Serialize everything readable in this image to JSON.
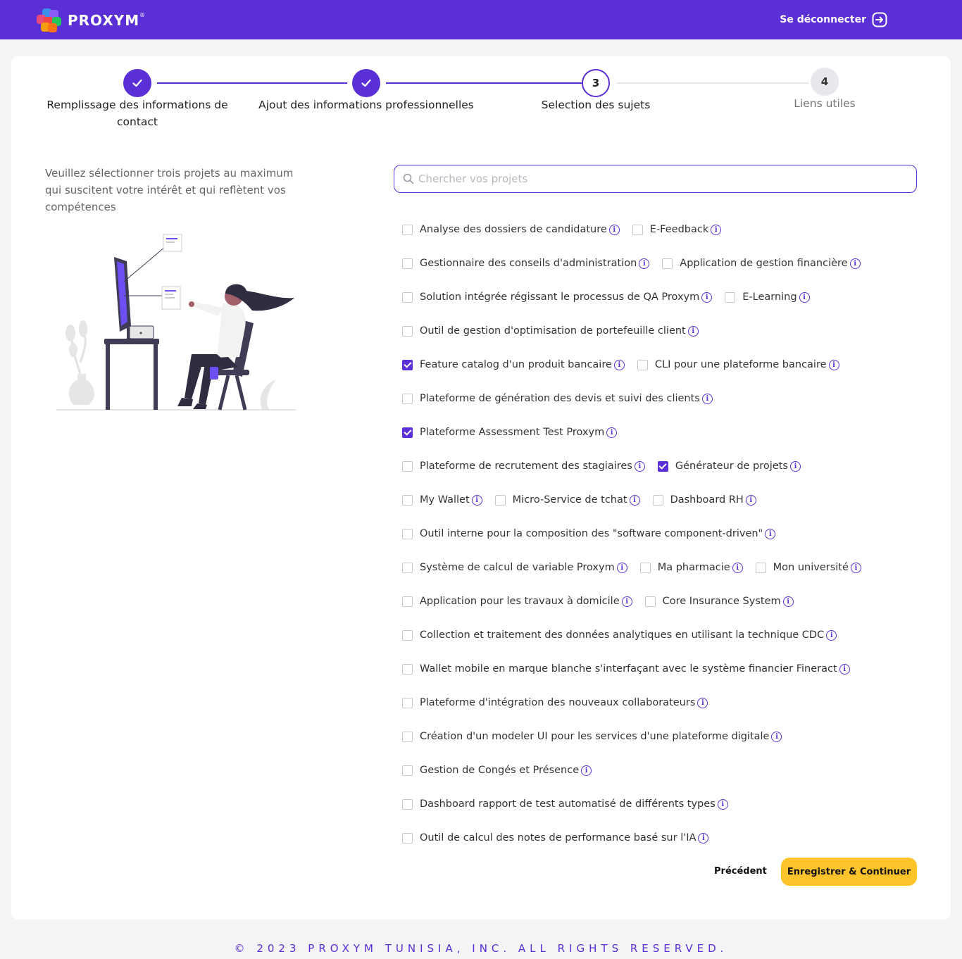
{
  "header": {
    "brand": "PROXYM",
    "brand_mark": "®",
    "logout_label": "Se déconnecter"
  },
  "steps": [
    {
      "number": "1",
      "label": "Remplissage des informations de contact",
      "state": "done"
    },
    {
      "number": "2",
      "label": "Ajout des informations professionnelles",
      "state": "done"
    },
    {
      "number": "3",
      "label": "Selection des sujets",
      "state": "active"
    },
    {
      "number": "4",
      "label": "Liens utiles",
      "state": "pending"
    }
  ],
  "intro_text": "Veuillez sélectionner trois projets au maximum qui suscitent votre intérêt et qui reflètent vos compétences",
  "search": {
    "placeholder": "Chercher vos projets",
    "value": ""
  },
  "project_rows": [
    [
      {
        "label": "Analyse des dossiers de candidature",
        "checked": false
      },
      {
        "label": "E-Feedback",
        "checked": false
      }
    ],
    [
      {
        "label": "Gestionnaire des conseils d'administration",
        "checked": false
      },
      {
        "label": "Application de gestion financière",
        "checked": false
      }
    ],
    [
      {
        "label": "Solution intégrée régissant le processus de QA Proxym",
        "checked": false
      },
      {
        "label": "E-Learning",
        "checked": false
      }
    ],
    [
      {
        "label": "Outil de gestion d'optimisation de portefeuille client",
        "checked": false
      }
    ],
    [
      {
        "label": "Feature catalog d'un produit bancaire",
        "checked": true
      },
      {
        "label": "CLI pour une plateforme bancaire",
        "checked": false
      }
    ],
    [
      {
        "label": "Plateforme de génération des devis et suivi des clients",
        "checked": false
      }
    ],
    [
      {
        "label": "Plateforme Assessment Test Proxym",
        "checked": true
      }
    ],
    [
      {
        "label": "Plateforme de recrutement des stagiaires",
        "checked": false
      },
      {
        "label": "Générateur de projets",
        "checked": true
      }
    ],
    [
      {
        "label": "My Wallet",
        "checked": false
      },
      {
        "label": "Micro-Service de tchat",
        "checked": false
      },
      {
        "label": "Dashboard RH",
        "checked": false
      }
    ],
    [
      {
        "label": "Outil interne pour la composition des \"software component-driven\"",
        "checked": false
      }
    ],
    [
      {
        "label": "Système de calcul de variable Proxym",
        "checked": false
      },
      {
        "label": "Ma pharmacie",
        "checked": false
      },
      {
        "label": "Mon université",
        "checked": false
      }
    ],
    [
      {
        "label": "Application pour les travaux à domicile",
        "checked": false
      },
      {
        "label": "Core Insurance System",
        "checked": false
      }
    ],
    [
      {
        "label": "Collection et traitement des données analytiques en utilisant la technique CDC",
        "checked": false
      }
    ],
    [
      {
        "label": "Wallet mobile en marque blanche s'interfaçant avec le système financier Fineract",
        "checked": false
      }
    ],
    [
      {
        "label": "Plateforme d'intégration des nouveaux collaborateurs",
        "checked": false
      }
    ],
    [
      {
        "label": "Création d'un modeler UI pour les services d'une plateforme digitale",
        "checked": false
      }
    ],
    [
      {
        "label": "Gestion de Congés et Présence",
        "checked": false
      }
    ],
    [
      {
        "label": "Dashboard rapport de test automatisé de différents types",
        "checked": false
      }
    ],
    [
      {
        "label": "Outil de calcul des notes de performance basé sur l'IA",
        "checked": false
      }
    ]
  ],
  "info_glyph": "i",
  "buttons": {
    "previous": "Précédent",
    "save": "Enregistrer & Continuer"
  },
  "footer": "© 2023 PROXYM TUNISIA, INC. ALL RIGHTS RESERVED.",
  "colors": {
    "primary": "#5a2fd6",
    "accent": "#fec42c",
    "step_pending": "#e8e8ec"
  },
  "icons": {
    "done_step": "check-icon",
    "logout": "logout-arrow-icon",
    "search": "search-icon",
    "info": "info-icon"
  }
}
